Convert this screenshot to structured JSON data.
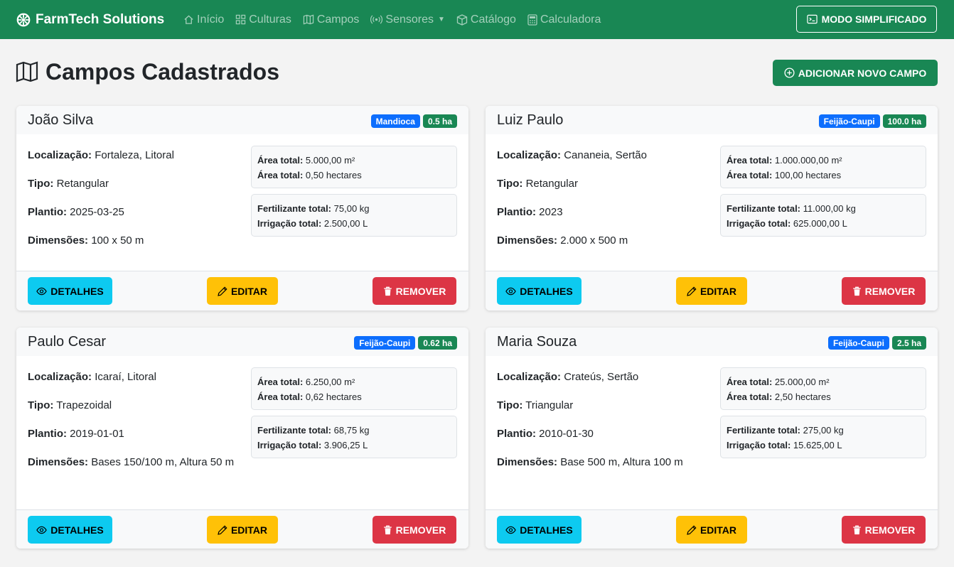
{
  "navbar": {
    "brand": "FarmTech Solutions",
    "items": [
      {
        "label": "Início",
        "icon": "house-icon"
      },
      {
        "label": "Culturas",
        "icon": "grid-icon"
      },
      {
        "label": "Campos",
        "icon": "map-icon"
      },
      {
        "label": "Sensores",
        "icon": "broadcast-icon"
      },
      {
        "label": "Catálogo",
        "icon": "box-icon"
      },
      {
        "label": "Calculadora",
        "icon": "calculator-icon"
      }
    ],
    "mode_button": "MODO SIMPLIFICADO"
  },
  "page": {
    "title": "Campos Cadastrados",
    "add_button": "ADICIONAR NOVO CAMPO"
  },
  "labels": {
    "localizacao": "Localização:",
    "tipo": "Tipo:",
    "plantio": "Plantio:",
    "dimensoes": "Dimensões:",
    "area_total": "Área total:",
    "fertilizante_total": "Fertilizante total:",
    "irrigacao_total": "Irrigação total:"
  },
  "buttons": {
    "details": "DETALHES",
    "edit": "EDITAR",
    "remove": "REMOVER"
  },
  "colors": {
    "success": "#198754",
    "primary": "#0d6efd",
    "info": "#0dcaf0",
    "warning": "#ffc107",
    "danger": "#dc3545"
  },
  "fields": [
    {
      "name": "João Silva",
      "crop": "Mandioca",
      "size": "0.5 ha",
      "localizacao": "Fortaleza, Litoral",
      "tipo": "Retangular",
      "plantio": "2025-03-25",
      "dimensoes": "100 x 50 m",
      "area_m2": "5.000,00 m²",
      "area_ha": "0,50 hectares",
      "fertilizante": "75,00 kg",
      "irrigacao": "2.500,00 L"
    },
    {
      "name": "Luiz Paulo",
      "crop": "Feijão-Caupi",
      "size": "100.0 ha",
      "localizacao": "Cananeia, Sertão",
      "tipo": "Retangular",
      "plantio": "2023",
      "dimensoes": "2.000 x 500 m",
      "area_m2": "1.000.000,00 m²",
      "area_ha": "100,00 hectares",
      "fertilizante": "11.000,00 kg",
      "irrigacao": "625.000,00 L"
    },
    {
      "name": "Paulo Cesar",
      "crop": "Feijão-Caupi",
      "size": "0.62 ha",
      "localizacao": "Icaraí, Litoral",
      "tipo": "Trapezoidal",
      "plantio": "2019-01-01",
      "dimensoes": "Bases 150/100 m, Altura 50 m",
      "area_m2": "6.250,00 m²",
      "area_ha": "0,62 hectares",
      "fertilizante": "68,75 kg",
      "irrigacao": "3.906,25 L"
    },
    {
      "name": "Maria Souza",
      "crop": "Feijão-Caupi",
      "size": "2.5 ha",
      "localizacao": "Crateús, Sertão",
      "tipo": "Triangular",
      "plantio": "2010-01-30",
      "dimensoes": "Base 500 m, Altura 100 m",
      "area_m2": "25.000,00 m²",
      "area_ha": "2,50 hectares",
      "fertilizante": "275,00 kg",
      "irrigacao": "15.625,00 L"
    }
  ]
}
